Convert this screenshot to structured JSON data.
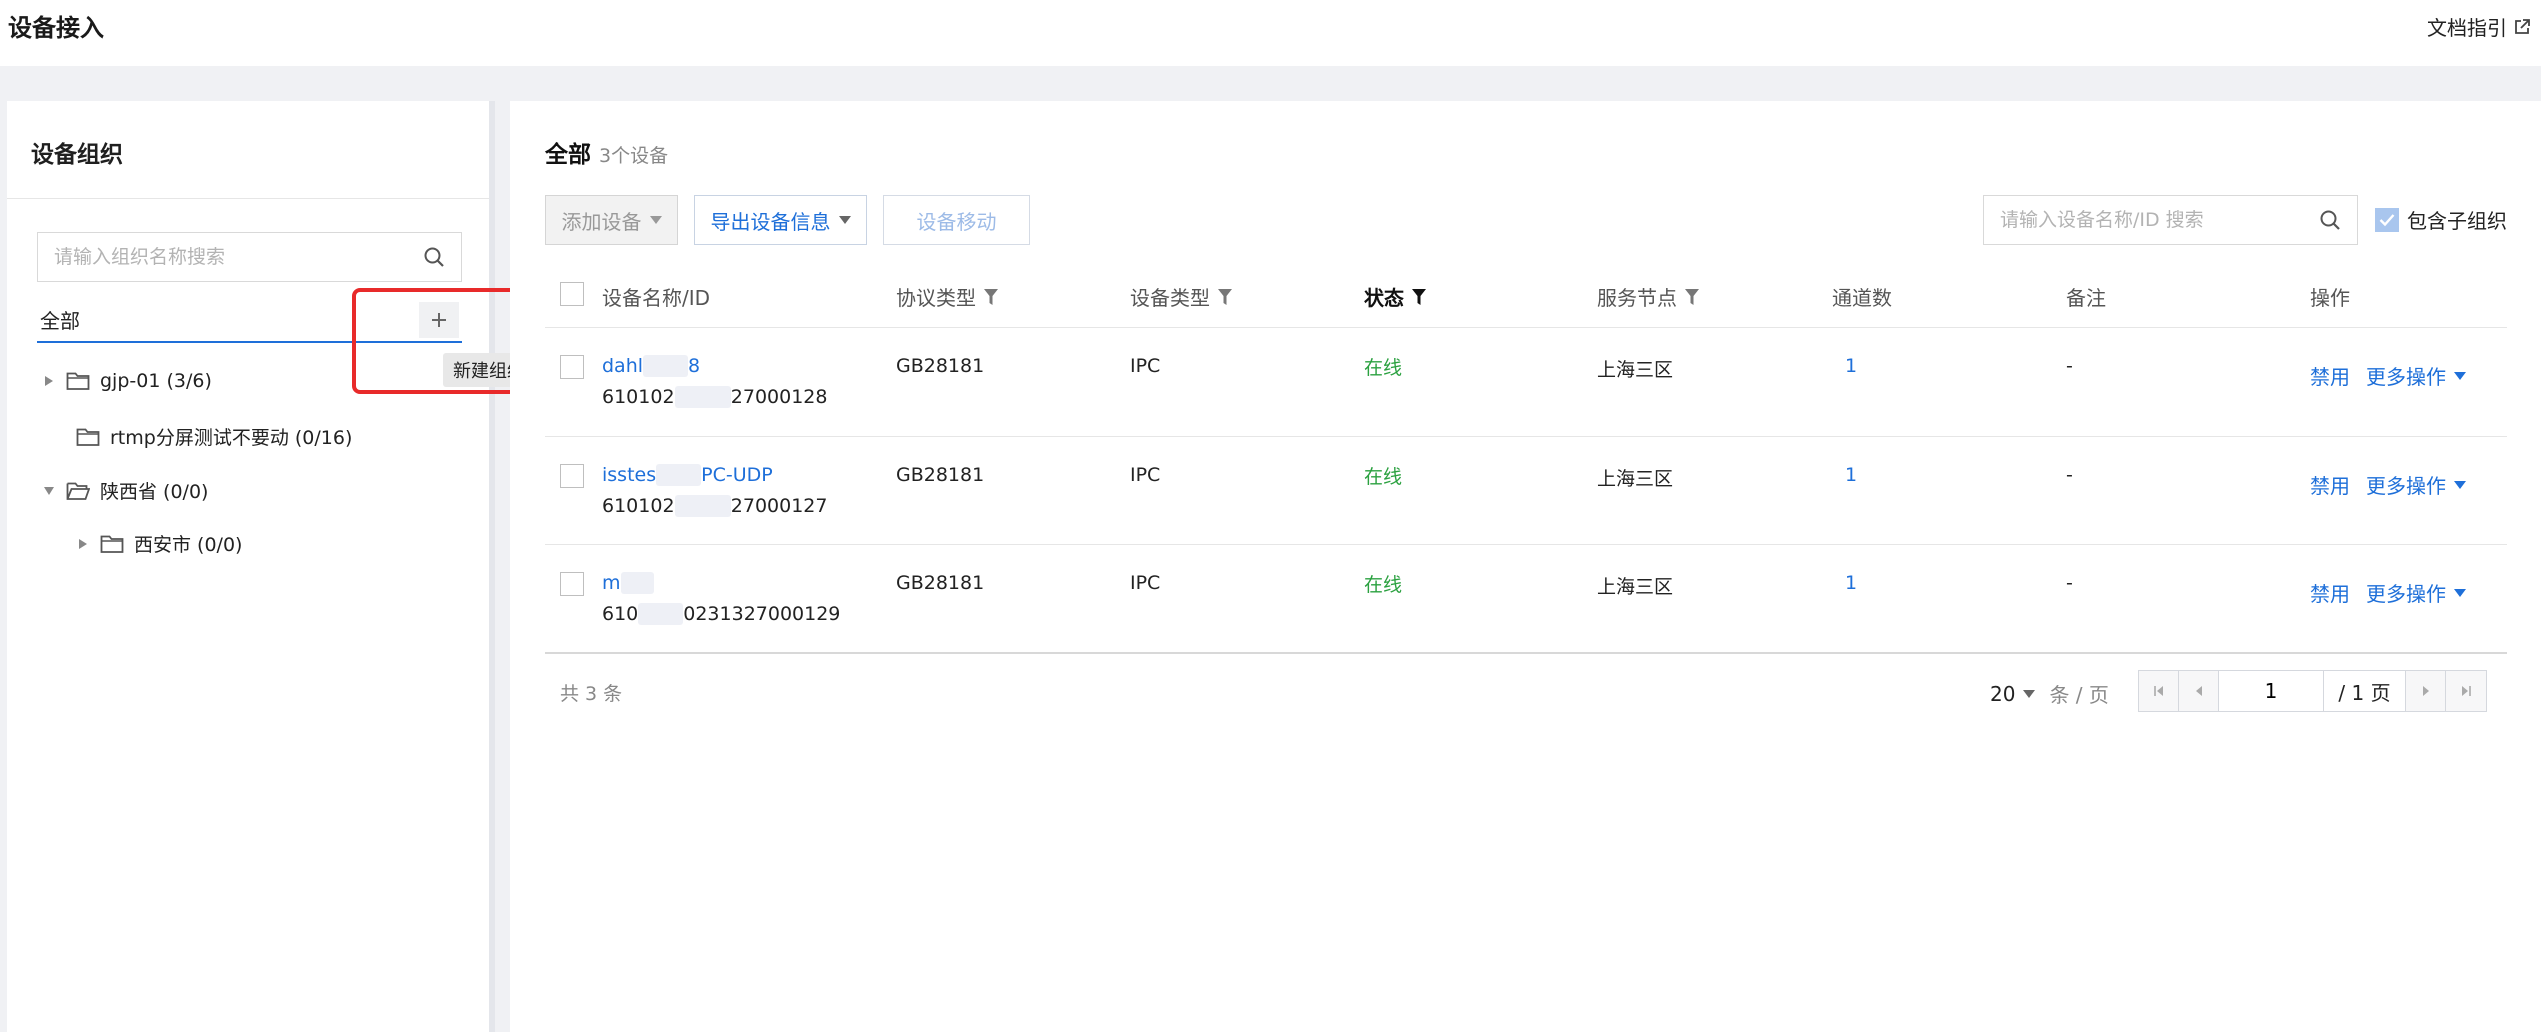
{
  "header": {
    "title": "设备接入",
    "doc_link": "文档指引"
  },
  "sidebar": {
    "title": "设备组织",
    "search_placeholder": "请输入组织名称搜索",
    "all_label": "全部",
    "add_tooltip": "新建组织",
    "tree": [
      {
        "label": "gjp-01 (3/6)",
        "expanded": false
      },
      {
        "label": "rtmp分屏测试不要动 (0/16)"
      },
      {
        "label": "陕西省 (0/0)",
        "expanded": true
      },
      {
        "label": "西安市 (0/0)",
        "expanded": false
      }
    ]
  },
  "main": {
    "title": "全部",
    "count": "3个设备",
    "toolbar": {
      "add_device": "添加设备",
      "export": "导出设备信息",
      "move": "设备移动",
      "search_placeholder": "请输入设备名称/ID 搜索",
      "include_sub": "包含子组织"
    },
    "columns": [
      "设备名称/ID",
      "协议类型",
      "设备类型",
      "状态",
      "服务节点",
      "通道数",
      "备注",
      "操作"
    ],
    "rows": [
      {
        "name_a": "dahl",
        "name_b": "8",
        "id_a": "610102",
        "id_b": "27000128",
        "protocol": "GB28181",
        "type": "IPC",
        "status": "在线",
        "node": "上海三区",
        "channels": "1",
        "remark": "-",
        "op_disable": "禁用",
        "op_more": "更多操作"
      },
      {
        "name_a": "isstes",
        "name_b": "PC-UDP",
        "id_a": "610102",
        "id_b": "27000127",
        "protocol": "GB28181",
        "type": "IPC",
        "status": "在线",
        "node": "上海三区",
        "channels": "1",
        "remark": "-",
        "op_disable": "禁用",
        "op_more": "更多操作"
      },
      {
        "name_a": "m",
        "name_b": "",
        "id_a": "610",
        "id_b": "0231327000129",
        "protocol": "GB28181",
        "type": "IPC",
        "status": "在线",
        "node": "上海三区",
        "channels": "1",
        "remark": "-",
        "op_disable": "禁用",
        "op_more": "更多操作"
      }
    ],
    "footer": {
      "total": "共 3 条",
      "page_size": "20",
      "page_size_unit": "条 / 页",
      "current_page": "1",
      "total_pages": "/ 1 页"
    }
  },
  "colors": {
    "accent": "#1e6fd9",
    "online": "#2ba140",
    "highlight": "#e82a2a"
  }
}
